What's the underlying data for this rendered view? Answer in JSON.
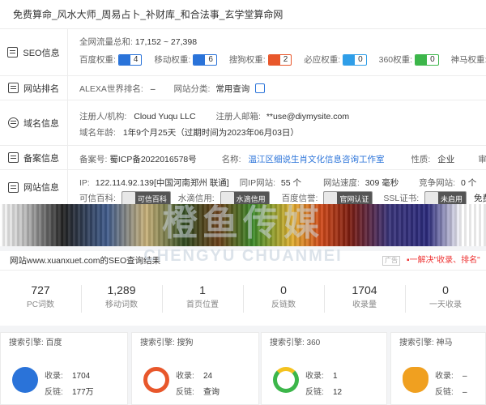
{
  "title": "免费算命_风水大师_周易占卜_补财库_和合法事_玄学堂算命网",
  "rows": {
    "seo": {
      "label": "SEO信息",
      "traffic_label": "全网流量总和:",
      "traffic_value": "17,152 ~ 27,398",
      "weights": [
        {
          "name": "百度权重:",
          "value": "4",
          "color": "#2a73d9",
          "icon": "paw-icon"
        },
        {
          "name": "移动权重:",
          "value": "6",
          "color": "#2a73d9",
          "icon": "paw-icon"
        },
        {
          "name": "搜狗权重:",
          "value": "2",
          "color": "#e8572b",
          "icon": "sogou-icon"
        },
        {
          "name": "必应权重:",
          "value": "0",
          "color": "#2f9ee8",
          "icon": "bing-icon"
        },
        {
          "name": "360权重:",
          "value": "0",
          "color": "#3cb64a",
          "icon": "360-icon"
        },
        {
          "name": "神马权重:",
          "value": "",
          "color": "#f0a020",
          "icon": "shenma-icon"
        }
      ]
    },
    "rank": {
      "label": "网站排名",
      "alexa_label": "ALEXA世界排名:",
      "alexa_value": "–",
      "category_label": "网站分类:",
      "category_value": "常用查询"
    },
    "domain": {
      "label": "域名信息",
      "registrant_label": "注册人/机构:",
      "registrant_value": "Cloud Yuqu LLC",
      "email_label": "注册人邮箱:",
      "email_value": "**use@diymysite.com",
      "age_label": "域名年龄:",
      "age_value": "1年9个月25天（过期时间为2023年06月03日）"
    },
    "icp": {
      "label": "备案信息",
      "icp_label": "备案号:",
      "icp_value": "蜀ICP备2022016578号",
      "name_label": "名称:",
      "name_value": "温江区细说生肖文化信息咨询工作室",
      "nature_label": "性质:",
      "nature_value": "企业",
      "audit_label": "审核时间"
    },
    "site": {
      "label": "网站信息",
      "ip_label": "IP:",
      "ip_value": "122.114.92.139[中国河南郑州 联通]",
      "sameip_label": "同IP网站:",
      "sameip_value": "55 个",
      "speed_label": "网站速度:",
      "speed_value": "309 毫秒",
      "compete_label": "竞争网站:",
      "compete_value": "0 个",
      "baike_label": "可信百科:",
      "baike_btn": "可信百科",
      "shuidi_label": "水滴信用:",
      "shuidi_btn": "水滴信用",
      "baidu_label": "百度信誉:",
      "baidu_btn": "官网认证",
      "ssl_label": "SSL证书:",
      "ssl_btn": "未启用",
      "free_apply": "免费申请"
    }
  },
  "watermark": {
    "cn": "橙鱼传媒",
    "en": "CHENGYU CHUANMEI"
  },
  "seo_summary": {
    "header": "网站www.xuanxuet.com的SEO查询结果",
    "ad": "广告",
    "tip": "▪一解决\"收录、排名\"",
    "stats": [
      {
        "value": "727",
        "label": "PC词数"
      },
      {
        "value": "1,289",
        "label": "移动词数"
      },
      {
        "value": "1",
        "label": "首页位置"
      },
      {
        "value": "0",
        "label": "反链数"
      },
      {
        "value": "1704",
        "label": "收录量"
      },
      {
        "value": "0",
        "label": "一天收录"
      }
    ]
  },
  "engines": [
    {
      "header": "搜索引擎: 百度",
      "logo": "baidu-logo",
      "color": "#2a73d9",
      "shoulu_label": "收录:",
      "shoulu": "1704",
      "fanlian_label": "反链:",
      "fanlian": "177万"
    },
    {
      "header": "搜索引擎: 搜狗",
      "logo": "sogou-logo",
      "color": "#e8572b",
      "shoulu_label": "收录:",
      "shoulu": "24",
      "fanlian_label": "反链:",
      "fanlian": "查询"
    },
    {
      "header": "搜索引擎: 360",
      "logo": "360-logo",
      "color": "#3cb64a",
      "shoulu_label": "收录:",
      "shoulu": "1",
      "fanlian_label": "反链:",
      "fanlian": "12"
    },
    {
      "header": "搜索引擎: 神马",
      "logo": "shenma-logo",
      "color": "#f0a020",
      "shoulu_label": "收录:",
      "shoulu": "–",
      "fanlian_label": "反链:",
      "fanlian": "–"
    }
  ]
}
